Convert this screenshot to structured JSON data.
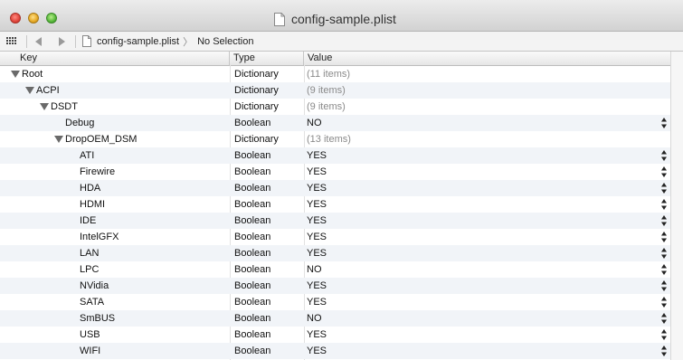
{
  "window": {
    "title": "config-sample.plist"
  },
  "jumpbar": {
    "filename": "config-sample.plist",
    "chevron": "〉",
    "selection": "No Selection"
  },
  "columns": {
    "key": "Key",
    "type": "Type",
    "value": "Value"
  },
  "rows": [
    {
      "key": "Root",
      "level": 0,
      "expanded": true,
      "type": "Dictionary",
      "value": "(11 items)",
      "dim": true,
      "stepper": false
    },
    {
      "key": "ACPI",
      "level": 1,
      "expanded": true,
      "type": "Dictionary",
      "value": "(9 items)",
      "dim": true,
      "stepper": false
    },
    {
      "key": "DSDT",
      "level": 2,
      "expanded": true,
      "type": "Dictionary",
      "value": "(9 items)",
      "dim": true,
      "stepper": false
    },
    {
      "key": "Debug",
      "level": 3,
      "expanded": false,
      "type": "Boolean",
      "value": "NO",
      "dim": false,
      "stepper": true
    },
    {
      "key": "DropOEM_DSM",
      "level": 3,
      "expanded": true,
      "type": "Dictionary",
      "value": "(13 items)",
      "dim": true,
      "stepper": false
    },
    {
      "key": "ATI",
      "level": 4,
      "expanded": false,
      "type": "Boolean",
      "value": "YES",
      "dim": false,
      "stepper": true
    },
    {
      "key": "Firewire",
      "level": 4,
      "expanded": false,
      "type": "Boolean",
      "value": "YES",
      "dim": false,
      "stepper": true
    },
    {
      "key": "HDA",
      "level": 4,
      "expanded": false,
      "type": "Boolean",
      "value": "YES",
      "dim": false,
      "stepper": true
    },
    {
      "key": "HDMI",
      "level": 4,
      "expanded": false,
      "type": "Boolean",
      "value": "YES",
      "dim": false,
      "stepper": true
    },
    {
      "key": "IDE",
      "level": 4,
      "expanded": false,
      "type": "Boolean",
      "value": "YES",
      "dim": false,
      "stepper": true
    },
    {
      "key": "IntelGFX",
      "level": 4,
      "expanded": false,
      "type": "Boolean",
      "value": "YES",
      "dim": false,
      "stepper": true
    },
    {
      "key": "LAN",
      "level": 4,
      "expanded": false,
      "type": "Boolean",
      "value": "YES",
      "dim": false,
      "stepper": true
    },
    {
      "key": "LPC",
      "level": 4,
      "expanded": false,
      "type": "Boolean",
      "value": "NO",
      "dim": false,
      "stepper": true
    },
    {
      "key": "NVidia",
      "level": 4,
      "expanded": false,
      "type": "Boolean",
      "value": "YES",
      "dim": false,
      "stepper": true
    },
    {
      "key": "SATA",
      "level": 4,
      "expanded": false,
      "type": "Boolean",
      "value": "YES",
      "dim": false,
      "stepper": true
    },
    {
      "key": "SmBUS",
      "level": 4,
      "expanded": false,
      "type": "Boolean",
      "value": "NO",
      "dim": false,
      "stepper": true
    },
    {
      "key": "USB",
      "level": 4,
      "expanded": false,
      "type": "Boolean",
      "value": "YES",
      "dim": false,
      "stepper": true
    },
    {
      "key": "WIFI",
      "level": 4,
      "expanded": false,
      "type": "Boolean",
      "value": "YES",
      "dim": false,
      "stepper": true
    }
  ],
  "icons": {
    "close": "close-button-icon",
    "minimize": "minimize-button-icon",
    "zoom": "zoom-button-icon",
    "document": "document-icon",
    "related_items": "grid-icon",
    "back": "back-arrow-icon",
    "forward": "forward-arrow-icon",
    "disclosure": "disclosure-triangle-icon",
    "stepper": "up-down-stepper-icon"
  },
  "colors": {
    "row_alt": "#f1f4f8",
    "value_dim": "#8a8a8a",
    "close": "#e0443a",
    "minimize": "#e5a823",
    "zoom": "#56b73a"
  }
}
